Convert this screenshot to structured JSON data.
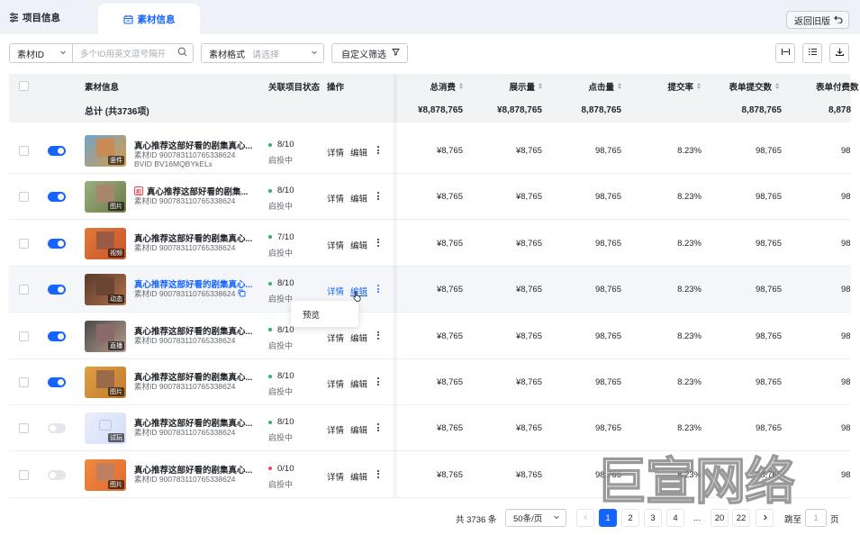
{
  "tabs": {
    "project": "项目信息",
    "material": "素材信息"
  },
  "back_button": "返回旧版",
  "filters": {
    "search_type": "素材ID",
    "search_placeholder": "多个ID用英文逗号隔开",
    "format_label": "素材格式",
    "format_placeholder": "请选择",
    "custom_filter": "自定义筛选"
  },
  "columns": {
    "material": "素材信息",
    "status": "关联项目状态",
    "ops": "操作",
    "cost": "总消费",
    "impressions": "展示量",
    "clicks": "点击量",
    "submit_rate": "提交率",
    "form_submits": "表单提交数",
    "form_pay": "表单付费数"
  },
  "summary": {
    "label": "总计 (共3736项)",
    "cost": "¥8,878,765",
    "impressions": "¥8,878,765",
    "clicks": "8,878,765",
    "submit_rate": "",
    "form_submits": "8,878,765",
    "form_pay": "8,878"
  },
  "rows": [
    {
      "enabled": true,
      "thumb_tag": "竖件",
      "title": "真心推荐这部好看的剧集真心...",
      "id_line": "素材ID 9007831107653386​24",
      "extra_line": "BVID BV16MQBYkELx",
      "status_value": "8/10",
      "status_dot": "#2fb463",
      "status_text": "启投中",
      "cost": "¥8,765",
      "impressions": "¥8,765",
      "clicks": "98,765",
      "submit_rate": "8.23%",
      "form_submits": "98,765",
      "form_pay": "98"
    },
    {
      "enabled": true,
      "thumb_tag": "图片",
      "title": "真心推荐这部好看的剧集...",
      "id_line": "素材ID 900783110765338624",
      "status_value": "8/10",
      "status_dot": "#2fb463",
      "status_text": "启投中",
      "cost": "¥8,765",
      "impressions": "¥8,765",
      "clicks": "98,765",
      "submit_rate": "8.23%",
      "form_submits": "98,765",
      "form_pay": "98"
    },
    {
      "enabled": true,
      "thumb_tag": "视频",
      "title": "真心推荐这部好看的剧集真心...",
      "id_line": "素材ID 900783110765338624",
      "status_value": "7/10",
      "status_dot": "#2fb463",
      "status_text": "启投中",
      "cost": "¥8,765",
      "impressions": "¥8,765",
      "clicks": "98,765",
      "submit_rate": "8.23%",
      "form_submits": "98,765",
      "form_pay": "98"
    },
    {
      "enabled": true,
      "thumb_tag": "动态",
      "title": "真心推荐这部好看的剧集真心...",
      "id_line": "素材ID 900783110765338624",
      "status_value": "8/10",
      "status_dot": "#2fb463",
      "status_text": "启投中",
      "cost": "¥8,765",
      "impressions": "¥8,765",
      "clicks": "98,765",
      "submit_rate": "8.23%",
      "form_submits": "98,765",
      "form_pay": "98"
    },
    {
      "enabled": true,
      "thumb_tag": "直播",
      "title": "真心推荐这部好看的剧集真心...",
      "id_line": "素材ID 900783110765338624",
      "status_value": "8/10",
      "status_dot": "#2fb463",
      "status_text": "启投中",
      "cost": "¥8,765",
      "impressions": "¥8,765",
      "clicks": "98,765",
      "submit_rate": "8.23%",
      "form_submits": "98,765",
      "form_pay": "98"
    },
    {
      "enabled": true,
      "thumb_tag": "图片",
      "title": "真心推荐这部好看的剧集真心...",
      "id_line": "素材ID 900783110765338624",
      "status_value": "8/10",
      "status_dot": "#2fb463",
      "status_text": "启投中",
      "cost": "¥8,765",
      "impressions": "¥8,765",
      "clicks": "98,765",
      "submit_rate": "8.23%",
      "form_submits": "98,765",
      "form_pay": "98"
    },
    {
      "enabled": false,
      "thumb_tag": "试玩",
      "title": "真心推荐这部好看的剧集真心...",
      "id_line": "素材ID 900783110765338624",
      "status_value": "8/10",
      "status_dot": "#2fb463",
      "status_text": "启投中",
      "cost": "¥8,765",
      "impressions": "¥8,765",
      "clicks": "98,765",
      "submit_rate": "8.23%",
      "form_submits": "98,765",
      "form_pay": "98"
    },
    {
      "enabled": false,
      "thumb_tag": "图片",
      "title": "真心推荐这部好看的剧集真心...",
      "id_line": "素材ID 900783110765338624",
      "status_value": "0/10",
      "status_dot": "#e34d59",
      "status_text": "启投中",
      "cost": "¥8,765",
      "impressions": "¥8,765",
      "clicks": "98,765",
      "submit_rate": "8.23%",
      "form_submits": "98,765",
      "form_pay": "98"
    }
  ],
  "row_actions": {
    "detail": "详情",
    "edit": "编辑"
  },
  "popup_menu": {
    "item": "预览"
  },
  "watermark": "巨宣网络",
  "pagination": {
    "total": "共 3736 条",
    "page_size": "50条/页",
    "pages": [
      "1",
      "2",
      "3",
      "4",
      "...",
      "20",
      "22"
    ],
    "current": "1",
    "jump_label": "跳至",
    "jump_value": "1",
    "page_suffix": "页"
  },
  "colors": {
    "accent": "#1664ff",
    "status_green": "#2fb463",
    "status_red": "#e34d59"
  }
}
